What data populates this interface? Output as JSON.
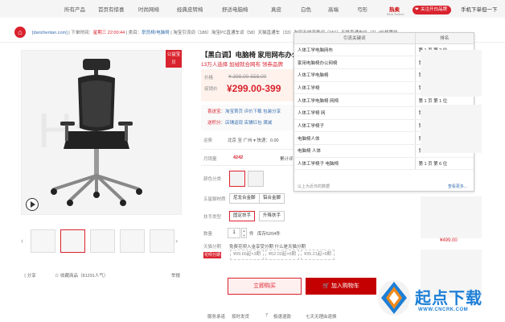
{
  "topnav": {
    "items": [
      "所有产品",
      "首页有惊喜",
      "时尚网椅",
      "经典皮转椅",
      "舒适电脑椅",
      "真皮",
      "白色",
      "高端",
      "弓形",
      "热卖"
    ],
    "hot_sub": "Best Sellers",
    "fav_label": "关注开白品牌",
    "mobile_label": "手机下单但一下"
  },
  "infobar": {
    "site": "[darizhentan.com]",
    "order_time_label": "下单时间：",
    "order_time": "星期三 22:00:44",
    "category_label": "类目：",
    "category": "职员椅/电脑椅",
    "stats": "淘宝引流词（186）淘宝PC直通车词（58）天猫直通车（33）淘宝无线流量词（151）天猫直通车位（2）|价格等级"
  },
  "product": {
    "badge": "公益宝贝",
    "title": "【黑白调】电脑椅 家用网布办公",
    "subtitle": "13万人选择 加绒就合网布 领券品牌",
    "price_label": "价格",
    "price_orig": "¥ 398.00-558.00",
    "promo_price_label": "促销价",
    "promo_price": "¥299.00-399",
    "promo_rows": [
      {
        "tag": "喜送宝",
        "text": "淘宝首页 评价下载 包装分享"
      },
      {
        "tag": "送积分",
        "text": "店铺返现 店铺红包 满减"
      }
    ],
    "ship_label": "运费",
    "ship_value": "北京 至 广州 ▾ 快递：0.00",
    "sales_label": "月销量",
    "sales_value": "4242",
    "sales_extra": "累计评",
    "color_label": "颜色分类",
    "frame_label": "五星脚材质",
    "frame_options": [
      "尼龙合金脚",
      "铝合金脚"
    ],
    "armrest_label": "扶手类型",
    "armrest_options": [
      "固定扶手",
      "升降扶手"
    ],
    "qty_label": "数量",
    "qty_value": "1",
    "qty_unit": "件",
    "stock": "库存5204件",
    "tm_label": "天猫分期",
    "tm_tag": "花呗分期",
    "tm_note": "免费花呗入金享受分期 什么是天猫分期",
    "coupons": [
      "¥99.66起×3期",
      "¥52.02起×6期",
      "¥35.21起×9期"
    ],
    "buy_label": "立即购买",
    "cart_label": "加入购物车",
    "services": [
      "服务承诺",
      "按时发货",
      "极速退款",
      "七天无理由退换"
    ],
    "services_badge": "7"
  },
  "gallery": {
    "share_label": "分享",
    "fav_label": "收藏商品（81291人气）",
    "report_label": "举报"
  },
  "keyword_panel": {
    "col1": "引流关键词",
    "col2": "排名",
    "rows": [
      {
        "kw": "人体工学电脑网布",
        "rank": "第 1 页 第 2 位"
      },
      {
        "kw": "家用电脑椅办公网椅",
        "rank": "第 1 页 第 1 位"
      },
      {
        "kw": "人体工学电脑椅",
        "rank": "第 1 页 第 3 位"
      },
      {
        "kw": "人体工学椅",
        "rank": "第 1 页 第 3 位"
      },
      {
        "kw": "人体工学电脑椅 网椅",
        "rank": "第 1 页 第 1 位"
      },
      {
        "kw": "人体工学椅 网",
        "rank": "第 1 页 第 3 位"
      },
      {
        "kw": "人体工学椅子",
        "rank": "第 1 页 第 3 位"
      },
      {
        "kw": "电脑椅人体",
        "rank": "第 1 页 第 4 位"
      },
      {
        "kw": "电脑椅 人体",
        "rank": "第 1 页 第 4 位"
      },
      {
        "kw": "人体工学椅子 电脑椅",
        "rank": "第 1 页 第 6 位"
      }
    ],
    "footer_note": "以上为近日的数据",
    "more_label": "查看更多..."
  },
  "right_strip": {
    "price": "¥499.00"
  },
  "watermark": {
    "text": "起点下载",
    "url": "WWW.CNCRK.COM"
  },
  "colors": {
    "brand_red": "#d9232e",
    "link_blue": "#3a6fb0",
    "watermark_blue": "#1d7fd6"
  }
}
